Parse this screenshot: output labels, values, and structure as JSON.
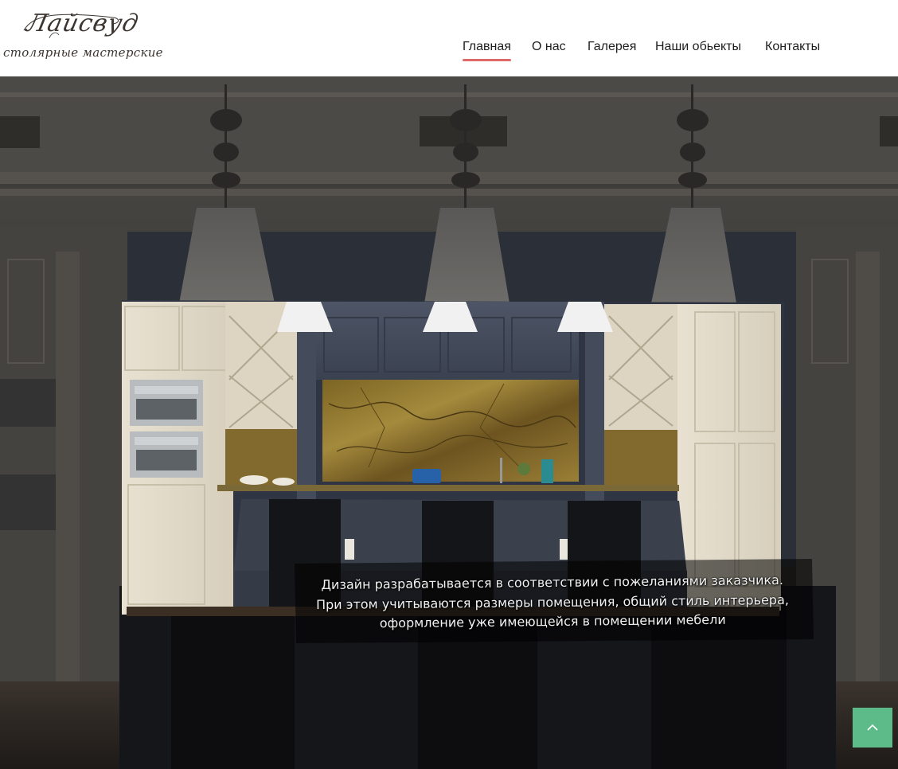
{
  "logo": {
    "script_text": "Лайсвуд",
    "subtitle": "столярные мастерские"
  },
  "nav": {
    "items": [
      {
        "label": "Главная",
        "active": true
      },
      {
        "label": "О нас",
        "active": false
      },
      {
        "label": "Галерея",
        "active": false
      },
      {
        "label": "Наши обьекты",
        "active": false
      },
      {
        "label": "Контакты",
        "active": false
      }
    ]
  },
  "hero": {
    "caption_lines": [
      "Дизайн разрабатывается в соответствии с пожеланиями заказчика.",
      "При этом учитываются размеры помещения, общий стиль интерьера,",
      "оформление уже имеющейся в помещении мебели"
    ]
  },
  "scroll_top": {
    "icon": "chevron-up-icon"
  },
  "colors": {
    "accent_underline": "#e06a6a",
    "scroll_button": "#5dbb8a",
    "nav_text": "#1e1e1e",
    "logo_text": "#3c3530"
  }
}
